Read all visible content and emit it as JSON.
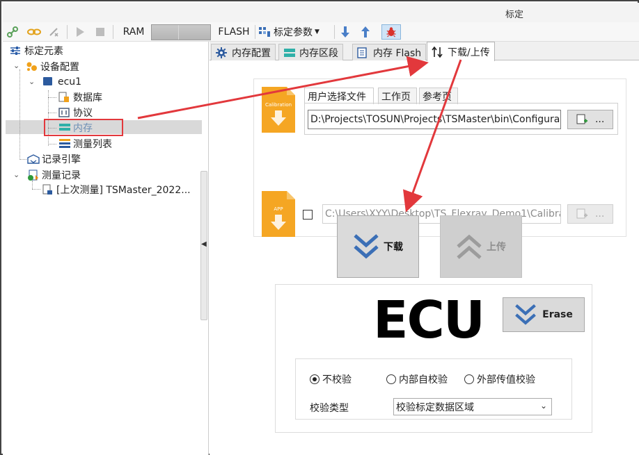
{
  "window": {
    "title": "标定"
  },
  "toolbar": {
    "ram_label": "RAM",
    "flash_label": "FLASH",
    "params_label": "标定参数",
    "icons": [
      "link-icon",
      "chain-icon",
      "unlink-icon",
      "play-icon",
      "stop-icon",
      "grid-icon",
      "arrow-down-icon",
      "arrow-up-icon",
      "bug-icon"
    ]
  },
  "tree": {
    "root": "标定元素",
    "device_config": "设备配置",
    "ecu": "ecu1",
    "database": "数据库",
    "protocol": "协议",
    "memory": "内存",
    "measure_list": "测量列表",
    "record_engine": "记录引擎",
    "measure_records": "测量记录",
    "last_measure": "[上次测量] TSMaster_2022..."
  },
  "tabs": [
    {
      "label": "内存配置",
      "icon": "gear-icon"
    },
    {
      "label": "内存区段",
      "icon": "segments-icon"
    },
    {
      "label": "内存 Flash",
      "icon": "document-icon"
    },
    {
      "label": "下载/上传",
      "icon": "updown-arrows-icon",
      "active": true
    }
  ],
  "file_panel": {
    "calibration_icon_text": "Calibration",
    "app_icon_text": "APP",
    "inner_tabs": [
      "用户选择文件",
      "工作页",
      "参考页"
    ],
    "calibration_path": "D:\\Projects\\TOSUN\\Projects\\TSMaster\\bin\\Configura",
    "app_path": "C:\\Users\\XYY\\Desktop\\TS_Flexray_Demo1\\Calibra",
    "browse_label": "..."
  },
  "actions": {
    "download_label": "下载",
    "upload_label": "上传"
  },
  "ecu_panel": {
    "big_label": "ECU",
    "erase_label": "Erase",
    "verify_options": [
      "不校验",
      "内部自校验",
      "外部传值校验"
    ],
    "selected_verify": 0,
    "verify_type_label": "校验类型",
    "verify_type_value": "校验标定数据区域"
  },
  "colors": {
    "highlight_red": "#e2383c",
    "chevron_blue": "#3b6fb6",
    "file_orange": "#f5a623"
  }
}
